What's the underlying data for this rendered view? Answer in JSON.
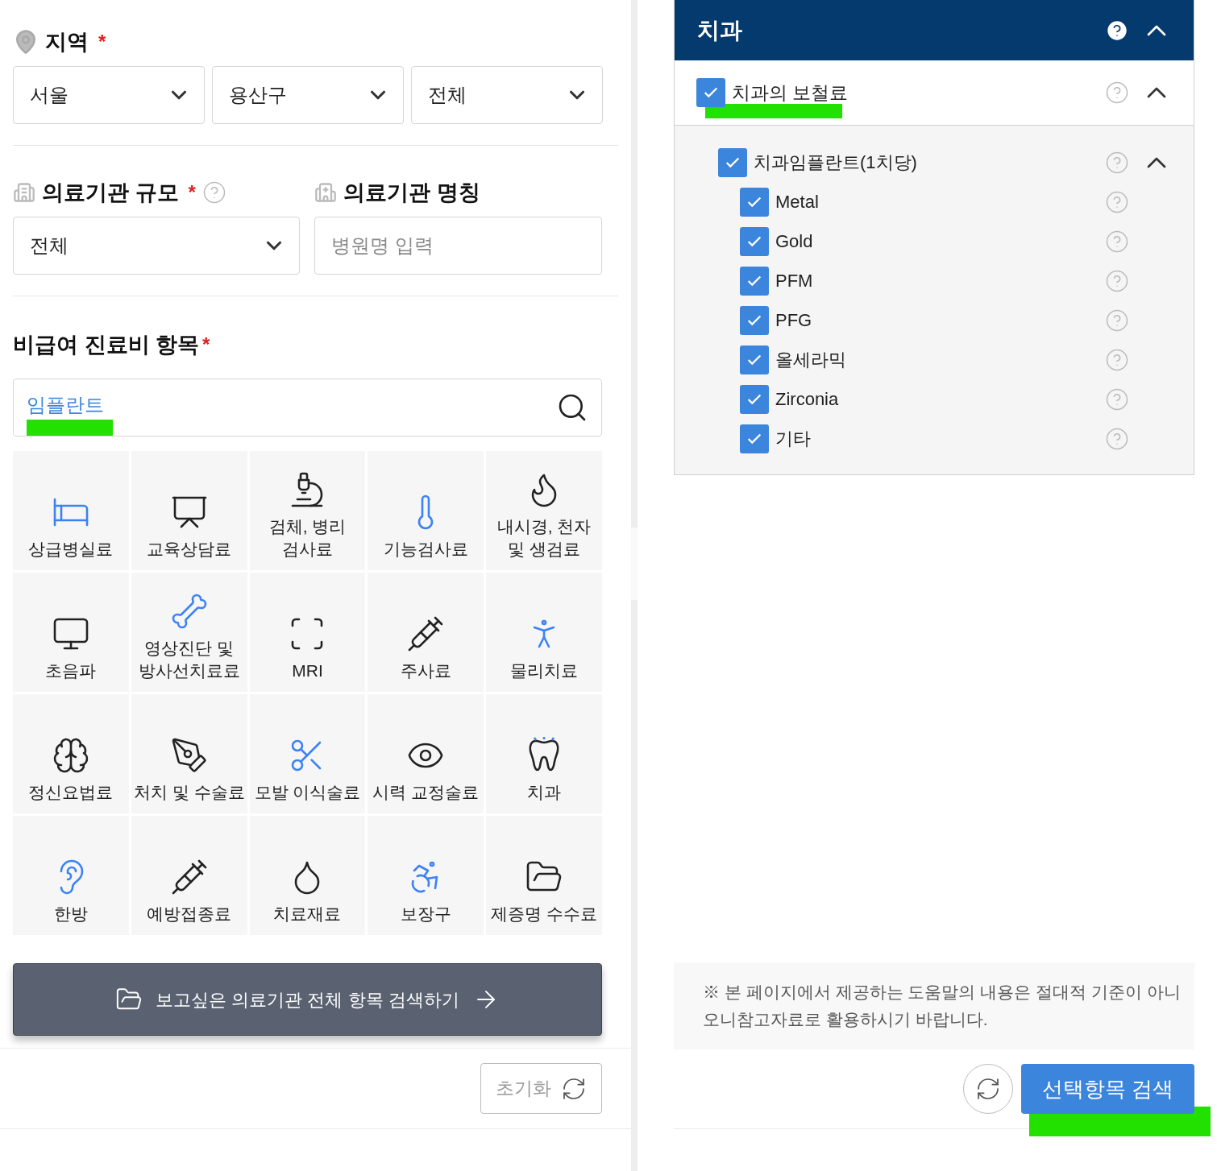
{
  "region": {
    "label": "지역",
    "required_mark": "*",
    "selects": [
      {
        "value": "서울"
      },
      {
        "value": "용산구"
      },
      {
        "value": "전체"
      }
    ]
  },
  "facility_scale": {
    "label": "의료기관 규모",
    "required_mark": "*",
    "select": {
      "value": "전체"
    }
  },
  "facility_name": {
    "label": "의료기관 명칭",
    "placeholder": "병원명 입력"
  },
  "items": {
    "label": "비급여 진료비 항목",
    "required_mark": "*",
    "search": {
      "value": "임플란트",
      "highlighted": true
    },
    "categories": [
      {
        "label": "상급병실료"
      },
      {
        "label": "교육상담료"
      },
      {
        "label": "검체, 병리\n검사료"
      },
      {
        "label": "기능검사료"
      },
      {
        "label": "내시경, 천자\n및 생검료"
      },
      {
        "label": "초음파"
      },
      {
        "label": "영상진단 및\n방사선치료료"
      },
      {
        "label": "MRI"
      },
      {
        "label": "주사료"
      },
      {
        "label": "물리치료"
      },
      {
        "label": "정신요법료"
      },
      {
        "label": "처치 및 수술료"
      },
      {
        "label": "모발 이식술료"
      },
      {
        "label": "시력 교정술료"
      },
      {
        "label": "치과"
      },
      {
        "label": "한방"
      },
      {
        "label": "예방접종료"
      },
      {
        "label": "치료재료"
      },
      {
        "label": "보장구"
      },
      {
        "label": "제증명 수수료"
      }
    ]
  },
  "all_search_button": {
    "label": "보고싶은 의료기관 전체 항목 검색하기"
  },
  "reset_button": {
    "label": "초기화"
  },
  "panel": {
    "title": "치과",
    "expanded": true,
    "tree": [
      {
        "label": "치과의 보철료",
        "checked": true,
        "expanded": true,
        "highlighted": true,
        "children": [
          {
            "label": "치과임플란트(1치당)",
            "checked": true,
            "expanded": true,
            "children": [
              {
                "label": "Metal",
                "checked": true
              },
              {
                "label": "Gold",
                "checked": true
              },
              {
                "label": "PFM",
                "checked": true
              },
              {
                "label": "PFG",
                "checked": true
              },
              {
                "label": "올세라믹",
                "checked": true
              },
              {
                "label": "Zirconia",
                "checked": true
              },
              {
                "label": "기타",
                "checked": true
              }
            ]
          }
        ]
      }
    ]
  },
  "notice": "※ 본 페이지에서 제공하는 도움말의 내용은 절대적 기준이 아니\n오니참고자료로 활용하시기 바랍니다.",
  "search_button": {
    "label": "선택항목 검색",
    "highlighted": true
  }
}
